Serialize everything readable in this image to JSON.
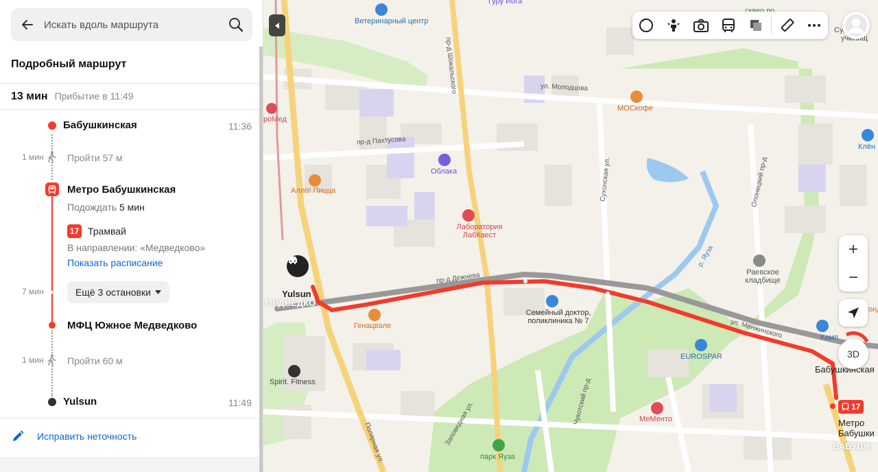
{
  "search": {
    "placeholder": "Искать вдоль маршрута"
  },
  "panel": {
    "title": "Подробный маршрут",
    "duration": "13 мин",
    "arrival": "Прибытие в 11:49",
    "start": {
      "name": "Бабушкинская",
      "time": "11:36"
    },
    "walk1": {
      "side_time": "1 мин",
      "text": "Пройти 57 м"
    },
    "station": {
      "name": "Метро Бабушкинская",
      "wait_prefix": "Подождать",
      "wait_value": "5 мин"
    },
    "tram": {
      "number": "17",
      "label": "Трамвай",
      "direction": "В направлении: «Медведково»",
      "schedule_link": "Показать расписание"
    },
    "ride": {
      "side_time": "7 мин",
      "more_stops": "Ещё 3 остановки"
    },
    "exit_stop": {
      "name": "МФЦ Южное Медведково"
    },
    "walk2": {
      "side_time": "1 мин",
      "text": "Пройти 60 м"
    },
    "end": {
      "name": "Yulsun",
      "time": "11:49"
    },
    "fix_link": "Исправить неточность"
  },
  "map": {
    "pois": {
      "vet": "Ветеринарный центр",
      "promed": "роМед",
      "pizza": "Алло! Пицца",
      "oblaka": "Облака",
      "lab": "Лаборатория ЛабКвест",
      "moscofe": "МОСкофе",
      "clinic": "Семейный доктор, поликлиника № 7",
      "genatsvale": "Генацвале",
      "spirit": "Spirit. Fitness",
      "eurospar": "EUROSPAR",
      "memento": "МеМенто",
      "park": "парк Яуза",
      "cemetery": "Раевское кладбище",
      "yulsun": "Yulsun",
      "kamp": "Камп",
      "klen": "Клён",
      "skver": "сквер по",
      "suhon": "Сухон",
      "uchilish": "училищ",
      "ond": "онд",
      "metro_babush": "Метро Бабушки",
      "babush_short": "Бабушкинская",
      "babush_big": "БАБУШК",
      "medvedk": "МЕДВЕДКО",
      "guru": "Гуру Йога"
    },
    "streets": {
      "molodtsova": "ул. Молодцова",
      "pakhtusova": "пр-д Пахтусова",
      "shokalskogo": "пр-д Шокальского",
      "dezhneva": "пр-д Дежнева",
      "menzhinskogo": "ул. Менжинского",
      "sukhonskaya": "Сухонская ул.",
      "olonetsky": "Олонецкий пр-д",
      "yauza": "р. Яуза",
      "chukotsky": "Чукотский пр-д",
      "zapovednaya": "Заповедная ул.",
      "polyarnaya": "Полярная ул."
    },
    "tram_badge": "17",
    "threed": "3D",
    "zoom_in": "+",
    "zoom_out": "−"
  },
  "colors": {
    "route": "#f33a2b",
    "link": "#0b66e4",
    "park": "#c9e8b4"
  }
}
